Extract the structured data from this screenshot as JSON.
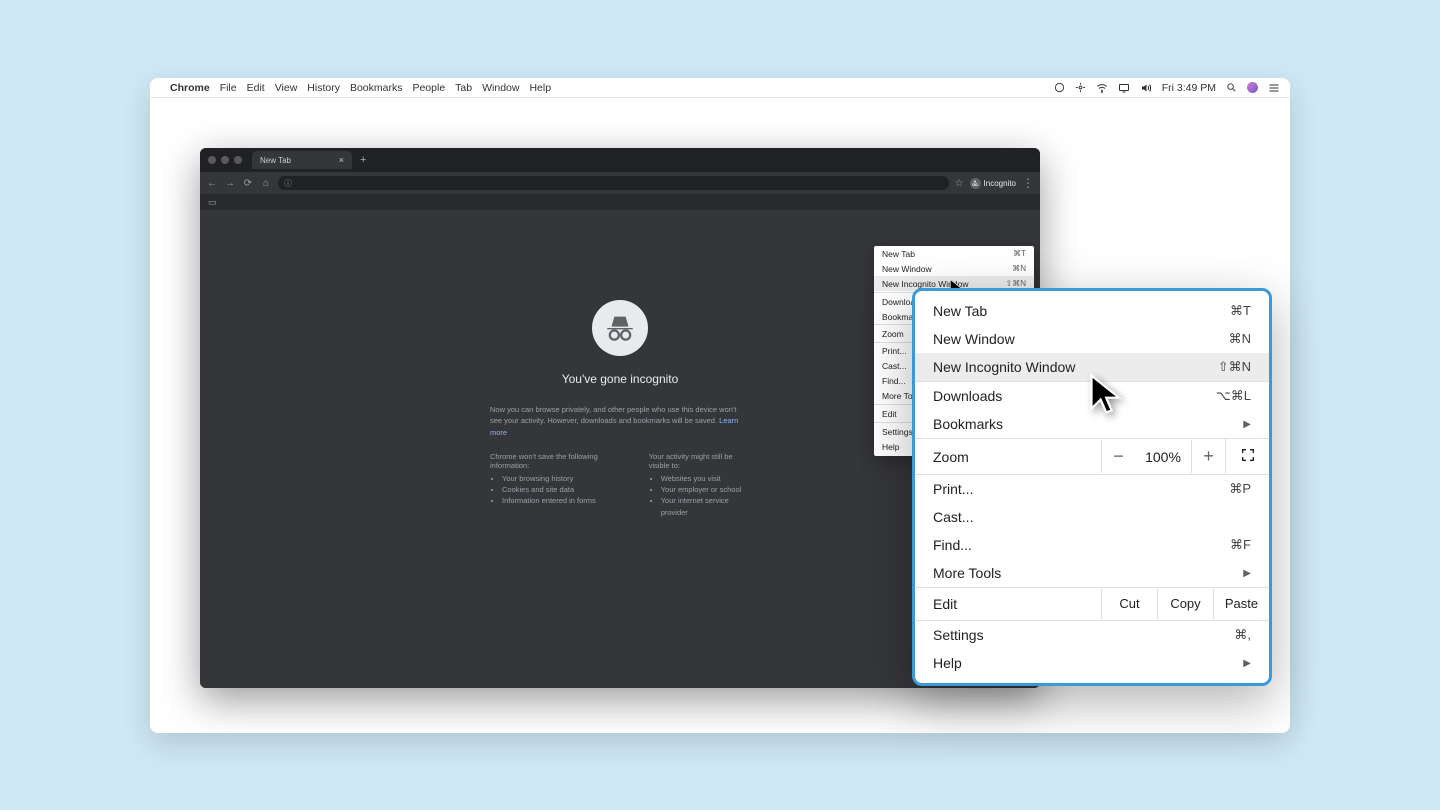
{
  "menubar": {
    "app": "Chrome",
    "items": [
      "File",
      "Edit",
      "View",
      "History",
      "Bookmarks",
      "People",
      "Tab",
      "Window",
      "Help"
    ],
    "time": "Fri 3:49 PM"
  },
  "tab": {
    "title": "New Tab"
  },
  "badge": {
    "label": "Incognito"
  },
  "incog": {
    "headline": "You've gone incognito",
    "para1": "Now you can browse privately, and other people who use this device won't see your activity. However, downloads and bookmarks will be saved.",
    "learn": "Learn more",
    "left_hdr": "Chrome won't save the following information:",
    "left_items": [
      "Your browsing history",
      "Cookies and site data",
      "Information entered in forms"
    ],
    "right_hdr": "Your activity might still be visible to:",
    "right_items": [
      "Websites you visit",
      "Your employer or school",
      "Your internet service provider"
    ]
  },
  "menu": {
    "new_tab": "New Tab",
    "new_tab_s": "⌘T",
    "new_window": "New Window",
    "new_window_s": "⌘N",
    "new_incog": "New Incognito Window",
    "new_incog_s": "⇧⌘N",
    "downloads": "Downloads",
    "downloads_s": "⌥⌘L",
    "bookmarks": "Bookmarks",
    "zoom": "Zoom",
    "zoom_val": "100%",
    "print": "Print...",
    "print_s": "⌘P",
    "cast": "Cast...",
    "find": "Find...",
    "find_s": "⌘F",
    "more_tools": "More Tools",
    "edit": "Edit",
    "cut": "Cut",
    "copy": "Copy",
    "paste": "Paste",
    "settings": "Settings",
    "settings_s": "⌘,",
    "help": "Help"
  }
}
